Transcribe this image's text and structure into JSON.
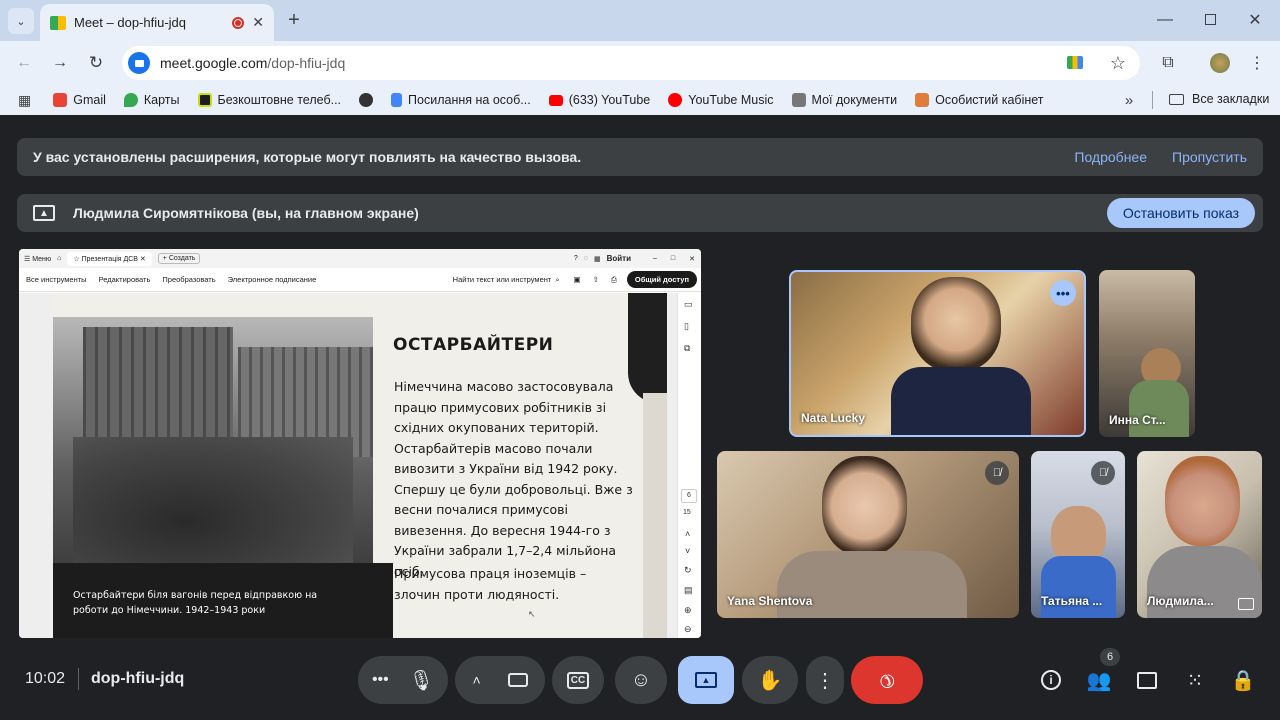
{
  "browser": {
    "tab_title": "Meet – dop-hfiu-jdq",
    "url_domain": "meet.google.com",
    "url_path": "/dop-hfiu-jdq",
    "bookmarks": [
      {
        "label": "Gmail",
        "color": "#ea4335"
      },
      {
        "label": "Карты",
        "color": "#34a853"
      },
      {
        "label": "Безкоштовне телеб...",
        "color": "#1e1e1e"
      },
      {
        "label": "",
        "color": "#333333"
      },
      {
        "label": "Посилання на особ...",
        "color": "#4285f4"
      },
      {
        "label": "(633) YouTube",
        "color": "#ff0000"
      },
      {
        "label": "YouTube Music",
        "color": "#ff0000"
      },
      {
        "label": "Мої документи",
        "color": "#555555"
      },
      {
        "label": "Особистий кабінет",
        "color": "#e07b39"
      }
    ],
    "all_bookmarks": "Все закладки"
  },
  "extension_banner": {
    "text": "У вас установлены расширения, которые могут повлиять на качество вызова.",
    "more": "Подробнее",
    "skip": "Пропустить"
  },
  "presenting_banner": {
    "text": "Людмила Сиромятнікова (вы, на главном экране)",
    "stop": "Остановить показ"
  },
  "shared_screen": {
    "topbar": {
      "menu": "Меню",
      "tab": "Презентація ДСВ",
      "create": "+ Создать",
      "signin": "Войти"
    },
    "toolbar": {
      "items": [
        "Все инструменты",
        "Редактировать",
        "Преобразовать",
        "Электронное подписание"
      ],
      "search": "Найти текст или инструмент",
      "share": "Общий доступ"
    },
    "side_numbers": [
      "6",
      "15"
    ],
    "slide": {
      "title": "ОСТАРБАЙТЕРИ",
      "paragraph": "Німеччина масово застосовувала працю примусових робітників зі східних окупованих територій. Остарбайтерів масово почали вивозити з України від 1942 року. Спершу це були добровольці. Вже з весни почалися примусові вивезення. До вересня 1944-го з України забрали 1,7–2,4 мільйона осіб.",
      "paragraph2": "Примусова праця іноземців – злочин проти людяності.",
      "caption": "Остарбайтери біля вагонів перед відправкою на роботи до Німеччини. 1942–1943 роки"
    }
  },
  "participants": [
    {
      "name": "Nata Lucky",
      "muted": false
    },
    {
      "name": "Инна Ст...",
      "muted": false
    },
    {
      "name": "Yana Shentova",
      "muted": true
    },
    {
      "name": "Татьяна ...",
      "muted": true
    },
    {
      "name": "Людмила...",
      "muted": false
    }
  ],
  "bottom": {
    "time": "10:02",
    "meeting_code": "dop-hfiu-jdq",
    "people_count": "6"
  }
}
